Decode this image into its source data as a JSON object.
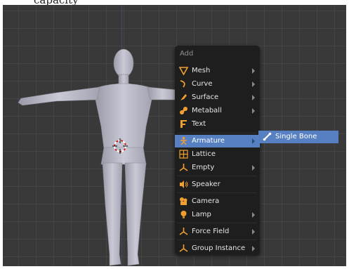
{
  "top_text": "capacity",
  "menu": {
    "title": "Add",
    "items": [
      {
        "label": "Mesh",
        "icon": "mesh-icon",
        "arrow": true
      },
      {
        "label": "Curve",
        "icon": "curve-icon",
        "arrow": true
      },
      {
        "label": "Surface",
        "icon": "surface-icon",
        "arrow": true
      },
      {
        "label": "Metaball",
        "icon": "metaball-icon",
        "arrow": true
      },
      {
        "label": "Text",
        "icon": "text-icon",
        "arrow": false
      },
      {
        "label": "Armature",
        "icon": "armature-icon",
        "arrow": true,
        "active": true
      },
      {
        "label": "Lattice",
        "icon": "lattice-icon",
        "arrow": false
      },
      {
        "label": "Empty",
        "icon": "empty-icon",
        "arrow": true
      },
      {
        "label": "Speaker",
        "icon": "speaker-icon",
        "arrow": false
      },
      {
        "label": "Camera",
        "icon": "camera-icon",
        "arrow": false
      },
      {
        "label": "Lamp",
        "icon": "lamp-icon",
        "arrow": true
      },
      {
        "label": "Force Field",
        "icon": "force-field-icon",
        "arrow": true
      },
      {
        "label": "Group Instance",
        "icon": "group-instance-icon",
        "arrow": true
      }
    ]
  },
  "submenu": {
    "items": [
      {
        "label": "Single Bone",
        "icon": "bone-icon"
      }
    ]
  },
  "colors": {
    "viewport_bg": "#393939",
    "menu_bg": "#1e1e1e",
    "highlight": "#5680c2",
    "icon_orange": "#f0a030"
  }
}
